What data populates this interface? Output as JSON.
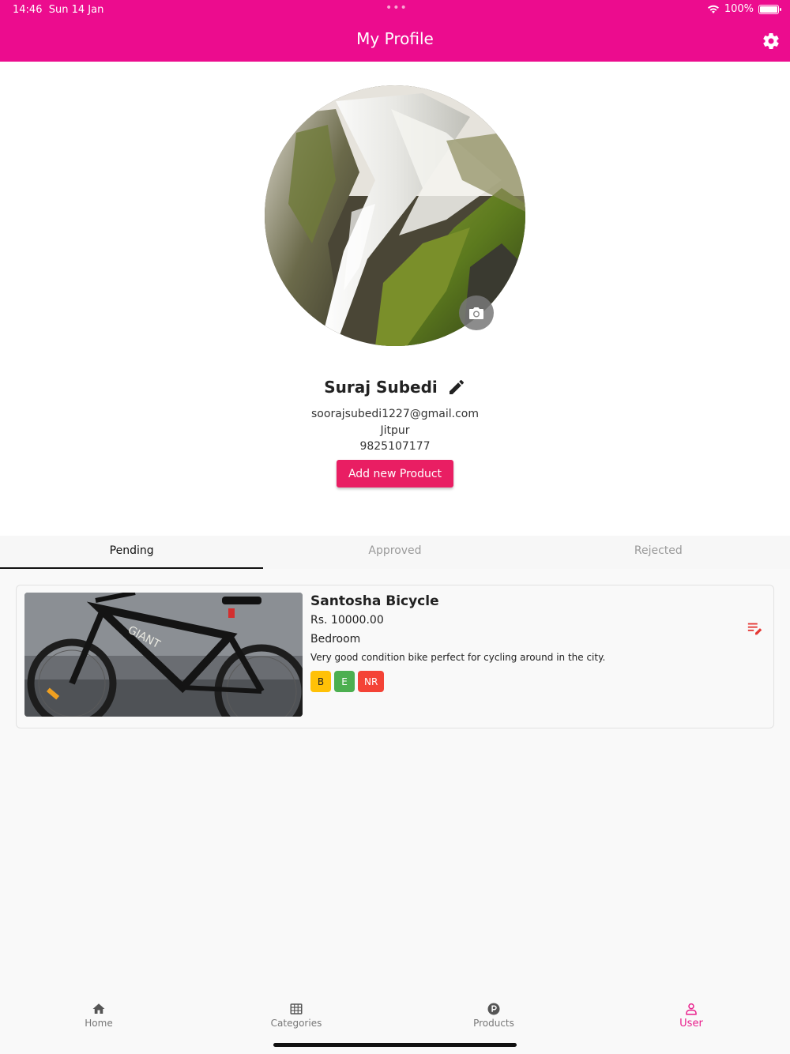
{
  "status_bar": {
    "time": "14:46",
    "date": "Sun 14 Jan",
    "dots": "•••",
    "battery": "100%"
  },
  "header": {
    "title": "My Profile",
    "settings_icon": "gear-icon",
    "color": "#ec0c8e"
  },
  "profile": {
    "name": "Suraj Subedi",
    "email": "soorajsubedi1227@gmail.com",
    "location": "Jitpur",
    "phone": "9825107177",
    "add_button": "Add new Product"
  },
  "tabs": [
    {
      "label": "Pending",
      "active": true
    },
    {
      "label": "Approved",
      "active": false
    },
    {
      "label": "Rejected",
      "active": false
    }
  ],
  "products": [
    {
      "title": "Santosha Bicycle",
      "price": "Rs. 10000.00",
      "location": "Bedroom",
      "description": "Very good condition bike perfect for cycling around in the city.",
      "tags": [
        {
          "label": "B",
          "color": "#ffc107",
          "text_color": "#222222"
        },
        {
          "label": "E",
          "color": "#4caf50",
          "text_color": "#ffffff"
        },
        {
          "label": "NR",
          "color": "#f44336",
          "text_color": "#ffffff"
        }
      ],
      "action_icon": "edit-list-icon"
    }
  ],
  "bottom_nav": [
    {
      "label": "Home",
      "icon": "home-icon",
      "active": false
    },
    {
      "label": "Categories",
      "icon": "grid-icon",
      "active": false
    },
    {
      "label": "Products",
      "icon": "p-circle-icon",
      "active": false
    },
    {
      "label": "User",
      "icon": "user-icon",
      "active": true
    }
  ],
  "colors": {
    "accent": "#e91e63",
    "brand": "#ec0c8e"
  }
}
